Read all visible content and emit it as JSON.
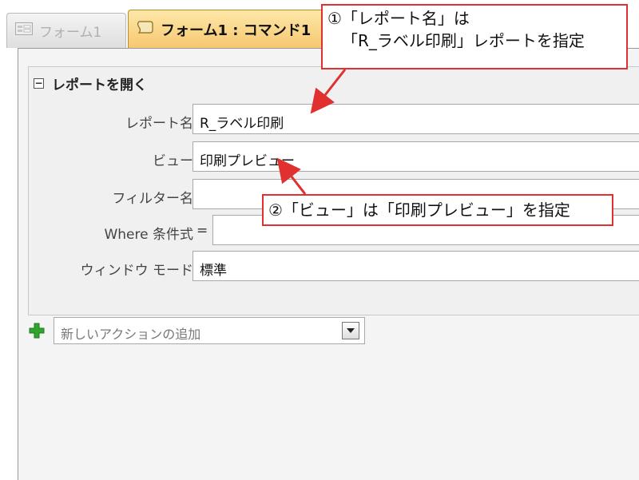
{
  "tabs": [
    {
      "label": "フォーム1",
      "active": false
    },
    {
      "label": "フォーム1 : コマンド1",
      "active": true
    }
  ],
  "group": {
    "title": "レポートを開く",
    "collapse_symbol": "⊟"
  },
  "fields": {
    "report_name": {
      "label": "レポート名",
      "value": "R_ラベル印刷"
    },
    "view": {
      "label": "ビュー",
      "value": "印刷プレビュー"
    },
    "filter_name": {
      "label": "フィルター名",
      "value": ""
    },
    "where": {
      "label": "Where 条件式",
      "prefix": "=",
      "value": ""
    },
    "window_mode": {
      "label": "ウィンドウ モード",
      "value": "標準"
    }
  },
  "add_action": {
    "placeholder": "新しいアクションの追加"
  },
  "callouts": {
    "c1_line1": "①「レポート名」は",
    "c1_line2": "「R_ラベル印刷」レポートを指定",
    "c2": "②「ビュー」は「印刷プレビュー」を指定"
  },
  "colors": {
    "callout_border": "#e03030",
    "active_tab": "#f7c770",
    "plus_icon": "#2fa52f"
  },
  "icons": {
    "form_tab_icon": "form-icon",
    "macro_tab_icon": "macro-icon",
    "add_icon": "plus-icon",
    "dropdown_icon": "chevron-down-icon"
  }
}
